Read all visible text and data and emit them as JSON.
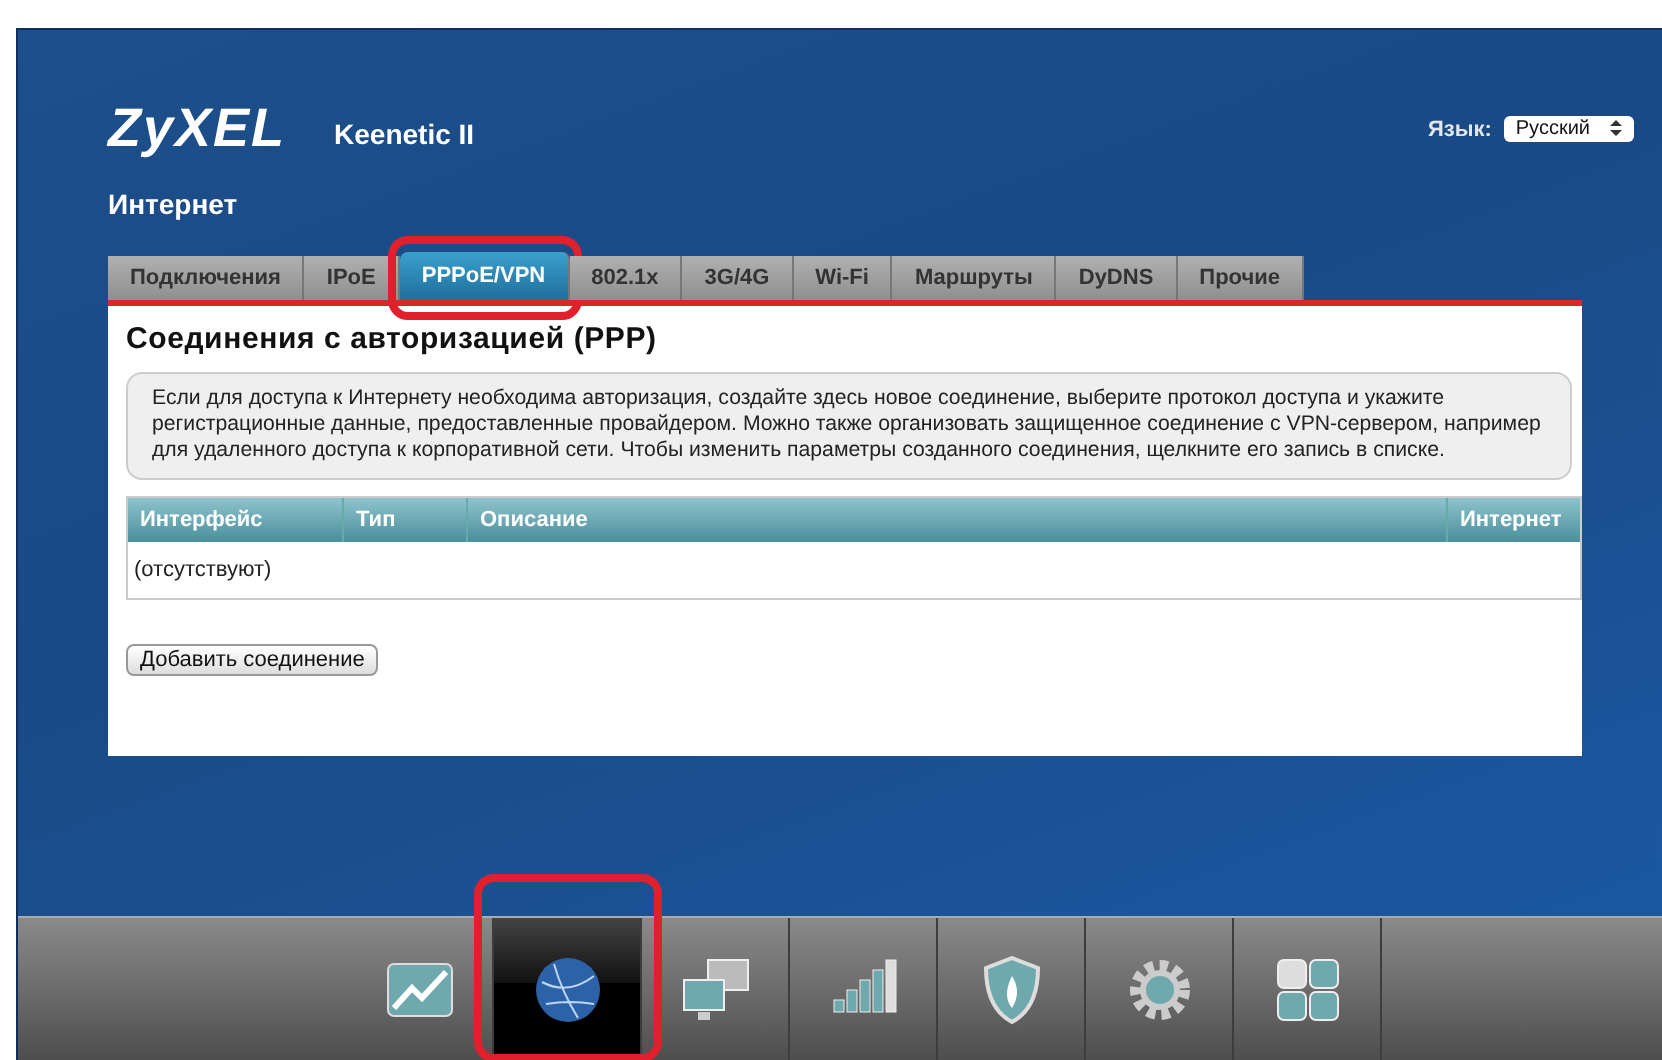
{
  "header": {
    "logo": "ZyXEL",
    "model": "Keenetic II",
    "language_label": "Язык:",
    "language_value": "Русский",
    "section": "Интернет"
  },
  "tabs": [
    {
      "label": "Подключения",
      "selected": false
    },
    {
      "label": "IPoE",
      "selected": false
    },
    {
      "label": "PPPoE/VPN",
      "selected": true,
      "highlighted": true
    },
    {
      "label": "802.1x",
      "selected": false
    },
    {
      "label": "3G/4G",
      "selected": false
    },
    {
      "label": "Wi-Fi",
      "selected": false
    },
    {
      "label": "Маршруты",
      "selected": false
    },
    {
      "label": "DyDNS",
      "selected": false
    },
    {
      "label": "Прочие",
      "selected": false
    }
  ],
  "panel": {
    "title": "Соединения с авторизацией (PPP)",
    "info": "Если для доступа к Интернету необходима авторизация, создайте здесь новое соединение, выберите протокол доступа и укажите регистрационные данные, предоставленные провайдером. Можно также организовать защищенное соединение с VPN-сервером, например для удаленного доступа к корпоративной сети. Чтобы изменить параметры созданного соединения, щелкните его запись в списке.",
    "table": {
      "columns": [
        "Интерфейс",
        "Тип",
        "Описание",
        "Интернет"
      ],
      "empty_text": "(отсутствуют)"
    },
    "add_button": "Добавить соединение"
  },
  "taskbar": [
    {
      "kind": "chart",
      "selected": false
    },
    {
      "kind": "globe",
      "selected": true,
      "highlighted": true
    },
    {
      "kind": "monitors",
      "selected": false
    },
    {
      "kind": "signal",
      "selected": false
    },
    {
      "kind": "shield",
      "selected": false
    },
    {
      "kind": "gear",
      "selected": false
    },
    {
      "kind": "grid",
      "selected": false
    }
  ]
}
